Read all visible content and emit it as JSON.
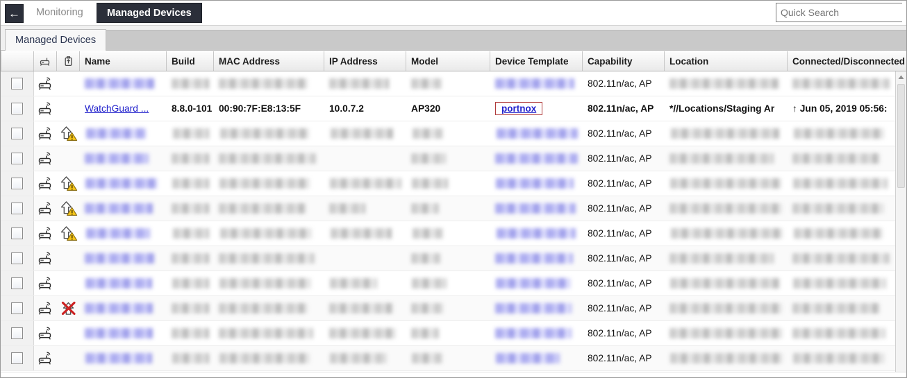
{
  "window": {
    "back_label": "←"
  },
  "breadcrumb": {
    "items": [
      {
        "label": "Monitoring",
        "active": false
      },
      {
        "label": "Managed Devices",
        "active": true
      }
    ]
  },
  "search": {
    "placeholder": "Quick Search",
    "value": "",
    "clear_label": "✕"
  },
  "subtabs": [
    {
      "label": "Managed Devices",
      "active": true
    }
  ],
  "grid": {
    "columns": [
      {
        "key": "check",
        "label": "",
        "width": 48,
        "icon": "checkbox-column"
      },
      {
        "key": "device",
        "label": "",
        "width": 33,
        "icon": "access-point-icon"
      },
      {
        "key": "upgrade",
        "label": "",
        "width": 33,
        "icon": "firmware-upgrade-icon"
      },
      {
        "key": "name",
        "label": "Name",
        "width": 125
      },
      {
        "key": "build",
        "label": "Build",
        "width": 68
      },
      {
        "key": "mac",
        "label": "MAC Address",
        "width": 159
      },
      {
        "key": "ip",
        "label": "IP Address",
        "width": 118
      },
      {
        "key": "model",
        "label": "Model",
        "width": 121
      },
      {
        "key": "template",
        "label": "Device Template",
        "width": 133
      },
      {
        "key": "capability",
        "label": "Capability",
        "width": 118
      },
      {
        "key": "location",
        "label": "Location",
        "width": 177
      },
      {
        "key": "connected",
        "label": "Connected/Disconnected",
        "width": 190
      }
    ],
    "rows": [
      {
        "redacted": true,
        "device_icon": "access-point-icon",
        "upgrade_icon": "",
        "capability": "802.11n/ac, AP"
      },
      {
        "redacted": false,
        "device_icon": "access-point-icon",
        "upgrade_icon": "",
        "name": "WatchGuard ...",
        "build": "8.8.0-101",
        "mac": "00:90:7F:E8:13:5F",
        "ip": "10.0.7.2",
        "model": "AP320",
        "template": "portnox",
        "capability": "802.11n/ac, AP",
        "location": "*//Locations/Staging Ar",
        "connected": "↑ Jun 05, 2019 05:56:",
        "selected": true
      },
      {
        "redacted": true,
        "device_icon": "access-point-icon",
        "upgrade_icon": "upgrade-warning-icon",
        "capability": "802.11n/ac, AP"
      },
      {
        "redacted": true,
        "device_icon": "access-point-icon",
        "upgrade_icon": "",
        "capability": "802.11n/ac, AP"
      },
      {
        "redacted": true,
        "device_icon": "access-point-icon",
        "upgrade_icon": "upgrade-warning-icon",
        "capability": "802.11n/ac, AP"
      },
      {
        "redacted": true,
        "device_icon": "access-point-icon",
        "upgrade_icon": "upgrade-warning-icon",
        "capability": "802.11n/ac, AP"
      },
      {
        "redacted": true,
        "device_icon": "access-point-icon",
        "upgrade_icon": "upgrade-warning-icon",
        "capability": "802.11n/ac, AP"
      },
      {
        "redacted": true,
        "device_icon": "access-point-icon",
        "upgrade_icon": "",
        "capability": "802.11n/ac, AP"
      },
      {
        "redacted": true,
        "device_icon": "access-point-icon",
        "upgrade_icon": "",
        "capability": "802.11n/ac, AP"
      },
      {
        "redacted": true,
        "device_icon": "access-point-icon",
        "upgrade_icon": "upgrade-blocked-icon",
        "capability": "802.11n/ac, AP"
      },
      {
        "redacted": true,
        "device_icon": "access-point-icon",
        "upgrade_icon": "",
        "capability": "802.11n/ac, AP"
      },
      {
        "redacted": true,
        "device_icon": "access-point-icon",
        "upgrade_icon": "",
        "capability": "802.11n/ac, AP"
      }
    ]
  },
  "colors": {
    "tab_active_bg": "#2b2f3a",
    "link": "#2222cc",
    "highlight_border": "#b03a3a",
    "warning": "#f5c518",
    "blocked": "#cc2020"
  }
}
